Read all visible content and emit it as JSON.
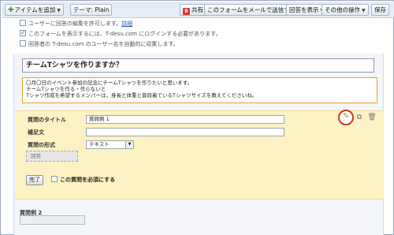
{
  "toolbar": {
    "add_item": "アイテムを追加",
    "theme": "テーマ: Plain",
    "share_icon_glyph": "8",
    "share": "共有",
    "email_form": "このフォームをメールで送信する",
    "show_responses": "回答を表示",
    "other_actions": "その他の操作",
    "save": "保存"
  },
  "options": {
    "allow_edit": "ユーザーに回答の編集を許可します。",
    "allow_edit_link": "詳細",
    "require_login": "このフォームを表示するには、T-desu.com にログインする必要があります。",
    "collect_username": "回答者の T-desu.com のユーザー名を自動的に収集します。"
  },
  "form": {
    "title": "チームTシャツを作りますか？",
    "description_lines": [
      "〇月〇日のイベント参加の記念にチームTシャツを作りたいと思います。",
      "チームTシャツを作る・作らないと",
      "Tシャツ作成を希望するメンバーは，身長と体重と普段着ているTシャツサイズを教えてくださいね。"
    ]
  },
  "question_editor": {
    "title_label": "質問のタイトル",
    "title_value": "質問例 1",
    "help_label": "補足文",
    "help_value": "",
    "type_label": "質問の形式",
    "type_value": "テキスト",
    "answer_placeholder": "回答",
    "done_label": "完了",
    "required_label": "この質問を必須にする"
  },
  "next_question": {
    "title": "質問例 2"
  },
  "icons": {
    "edit": "pencil-icon",
    "duplicate": "copy-icon",
    "delete": "trash-icon"
  },
  "colors": {
    "toolbar_bg": "#e6ecf5",
    "edit_panel_bg": "#fdf2c3",
    "focus_border": "#e8a12c",
    "highlight_ring": "#c9372c"
  }
}
